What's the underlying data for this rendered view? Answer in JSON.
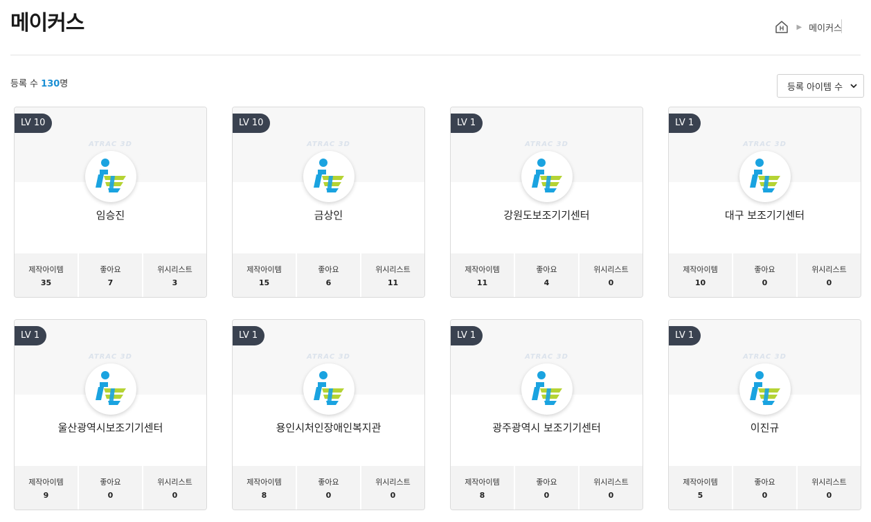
{
  "page": {
    "title": "메이커스"
  },
  "breadcrumb": {
    "home_icon": "home-icon",
    "current": "메이커스"
  },
  "summary": {
    "prefix": "등록 수 ",
    "count": "130",
    "suffix": "명"
  },
  "sort": {
    "selected": "등록 아이템 수"
  },
  "stat_labels": {
    "items": "제작아이템",
    "likes": "좋아요",
    "wishlist": "위시리스트"
  },
  "watermark": "ATRAC 3D",
  "makers": [
    {
      "level": "LV 10",
      "name": "임승진",
      "items": "35",
      "likes": "7",
      "wishlist": "3"
    },
    {
      "level": "LV 10",
      "name": "금상인",
      "items": "15",
      "likes": "6",
      "wishlist": "11"
    },
    {
      "level": "LV 1",
      "name": "강원도보조기기센터",
      "items": "11",
      "likes": "4",
      "wishlist": "0"
    },
    {
      "level": "LV 1",
      "name": "대구 보조기기센터",
      "items": "10",
      "likes": "0",
      "wishlist": "0"
    },
    {
      "level": "LV 1",
      "name": "울산광역시보조기기센터",
      "items": "9",
      "likes": "0",
      "wishlist": "0"
    },
    {
      "level": "LV 1",
      "name": "용인시처인장애인복지관",
      "items": "8",
      "likes": "0",
      "wishlist": "0"
    },
    {
      "level": "LV 1",
      "name": "광주광역시 보조기기센터",
      "items": "8",
      "likes": "0",
      "wishlist": "0"
    },
    {
      "level": "LV 1",
      "name": "이진규",
      "items": "5",
      "likes": "0",
      "wishlist": "0"
    }
  ],
  "colors": {
    "accent": "#1a8fd4",
    "logo_blue": "#1aa3e0",
    "logo_green": "#b5d334",
    "badge": "#3a4250"
  }
}
